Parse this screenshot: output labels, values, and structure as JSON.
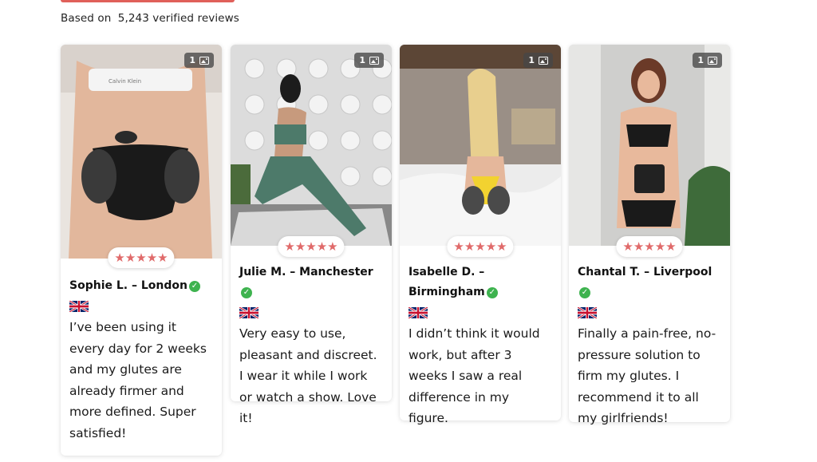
{
  "summary": {
    "prefix": "Based on",
    "count": "5,243 verified reviews"
  },
  "rating_stars": "★★★★★",
  "image_count": "1",
  "reviews": [
    {
      "name": "Sophie L. – London",
      "text": "I’ve been using it every day for 2 weeks and my glutes are already firmer and more defined. Super satisfied!"
    },
    {
      "name": "Julie M. – Manchester",
      "text": "Very easy to use, pleasant and discreet. I wear it while I work or watch a show. Love it!"
    },
    {
      "name": "Isabelle D. – Birmingham",
      "text": "I didn’t think it would work, but after 3 weeks I saw a real difference in my figure."
    },
    {
      "name": "Chantal T. – Liverpool",
      "text": "Finally a pain-free, no-pressure solution to firm my glutes. I recommend it to all my girlfriends!"
    }
  ],
  "colors": {
    "accent": "#e0605a",
    "stars": "#e06a6a",
    "verified": "#3eb34f"
  }
}
